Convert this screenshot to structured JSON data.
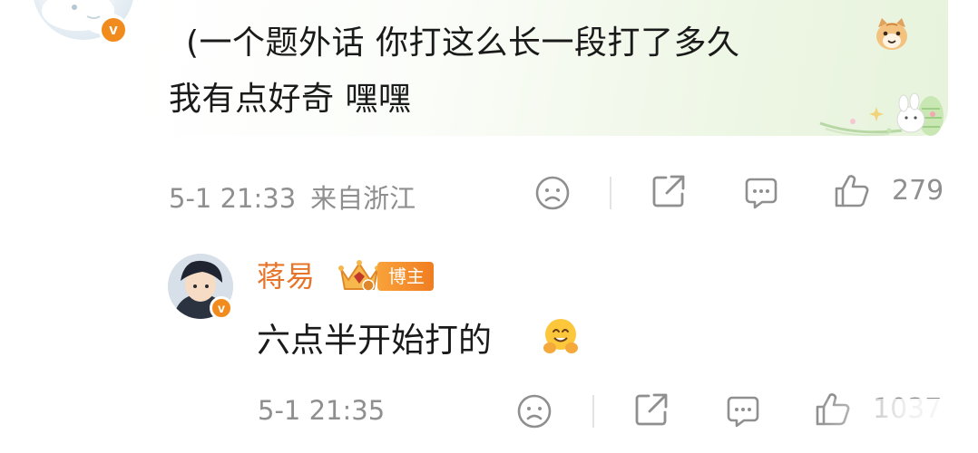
{
  "comment": {
    "text_line1": "(一个题外话 你打这么长一段打了多久",
    "text_line2": "我有点好奇 嘿嘿",
    "verified_mark": "v",
    "time": "5-1 21:33",
    "location": "来自浙江",
    "like_count": "279",
    "emoji": "cat-face-emoji"
  },
  "reply": {
    "username": "蒋易",
    "role_badge": "博主",
    "verified_mark": "v",
    "text": "六点半开始打的",
    "emoji": "hugging-face-emoji",
    "time": "5-1 21:35",
    "like_count": "1037"
  },
  "colors": {
    "username": "#e8742a",
    "meta": "#8f8f8f",
    "verified": "#f28b1e",
    "badge": "#f49032"
  },
  "icons": [
    "dislike-face-icon",
    "share-icon",
    "comment-icon",
    "like-thumb-icon"
  ]
}
